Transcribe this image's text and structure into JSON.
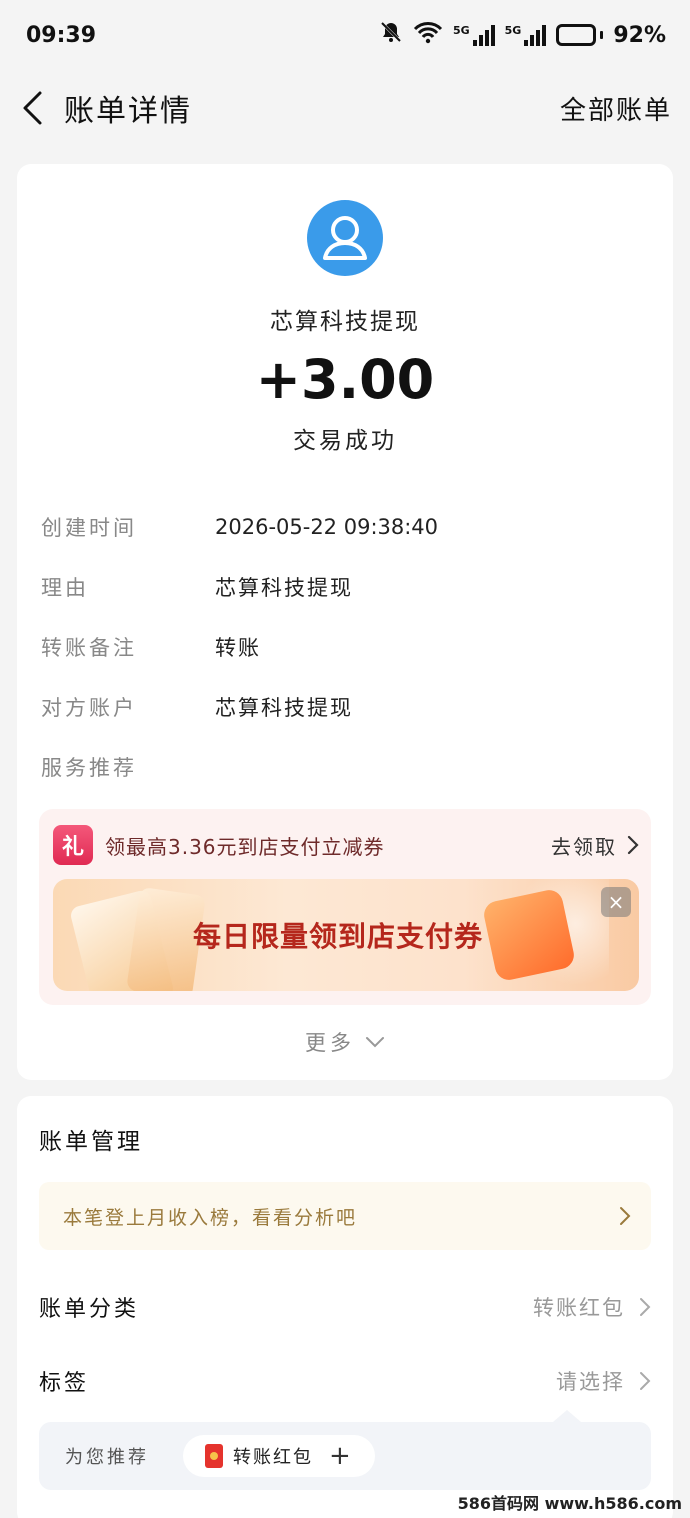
{
  "status_bar": {
    "time": "09:39",
    "network_1": "5G",
    "network_2": "5G",
    "battery": "92%",
    "battery_level": 0.92
  },
  "nav": {
    "title": "账单详情",
    "right_action": "全部账单"
  },
  "transaction": {
    "payee": "芯算科技提现",
    "amount": "+3.00",
    "status": "交易成功",
    "details": [
      {
        "label": "创建时间",
        "value": "2026-05-22 09:38:40"
      },
      {
        "label": "理由",
        "value": "芯算科技提现"
      },
      {
        "label": "转账备注",
        "value": "转账"
      },
      {
        "label": "对方账户",
        "value": "芯算科技提现"
      }
    ],
    "service_label": "服务推荐"
  },
  "promo": {
    "gift_glyph": "礼",
    "text": "领最高3.36元到店支付立减券",
    "cta": "去领取",
    "banner_text": "每日限量领到店支付券",
    "close_glyph": "×"
  },
  "more_label": "更多",
  "manage": {
    "title": "账单管理",
    "insight": "本笔登上月收入榜，看看分析吧",
    "category_label": "账单分类",
    "category_value": "转账红包",
    "tag_label": "标签",
    "tag_value": "请选择",
    "recommend_label": "为您推荐",
    "recommend_tag": "转账红包",
    "plus": "+"
  },
  "watermark": "586首码网 www.h586.com",
  "colors": {
    "avatar": "#3a9bea",
    "promo_bg": "#fdf2f1",
    "banner_text": "#b5271c",
    "insight_text": "#9a7a3c"
  }
}
